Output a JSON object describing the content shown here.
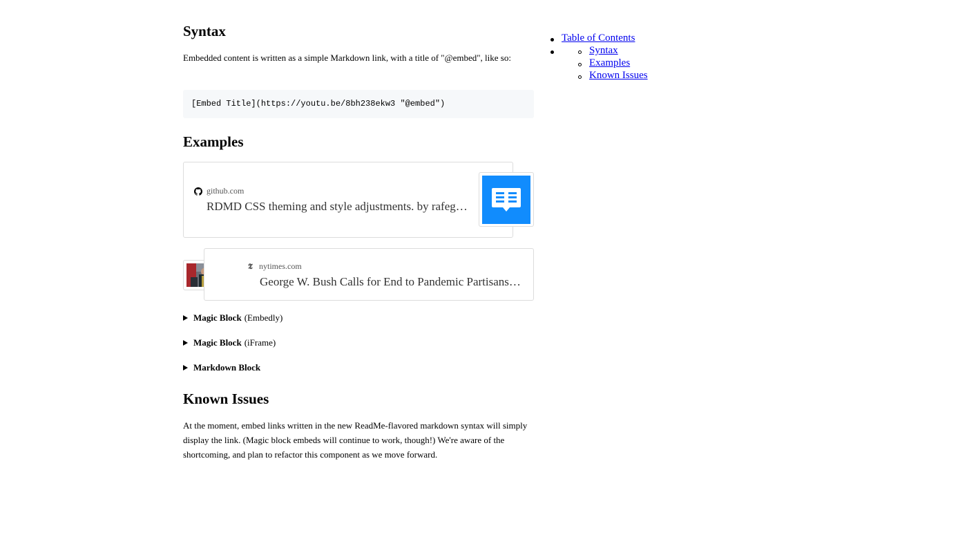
{
  "syntax": {
    "heading": "Syntax",
    "description": "Embedded content is written as a simple Markdown link, with a title of \"@embed\", like so:",
    "code": "[Embed Title](https://youtu.be/8bh238ekw3 \"@embed\")"
  },
  "examples": {
    "heading": "Examples",
    "embeds": [
      {
        "source": "github.com",
        "title": "RDMD CSS theming and style adjustments. by rafegoldberg · Pull Request",
        "source_icon": "github-icon",
        "thumb_icon": "document-icon"
      },
      {
        "source": "nytimes.com",
        "title": "George W. Bush Calls for End to Pandemic Partisanship",
        "source_icon": "nyt-icon",
        "thumb_icon": "news-photo"
      }
    ],
    "details": [
      {
        "bold": "Magic Block",
        "rest": "(Embedly)"
      },
      {
        "bold": "Magic Block",
        "rest": "(iFrame)"
      },
      {
        "bold": "Markdown Block",
        "rest": ""
      }
    ]
  },
  "known_issues": {
    "heading": "Known Issues",
    "body": "At the moment, embed links written in the new ReadMe-flavored markdown syntax will simply display the link. (Magic block embeds will continue to work, though!) We're aware of the shortcoming, and plan to refactor this component as we move forward."
  },
  "toc": {
    "title": "Table of Contents",
    "items": [
      "Syntax",
      "Examples",
      "Known Issues"
    ]
  },
  "colors": {
    "link": "#0000ee",
    "thumb_blue": "#118cfd",
    "code_bg": "#f6f8fa"
  }
}
